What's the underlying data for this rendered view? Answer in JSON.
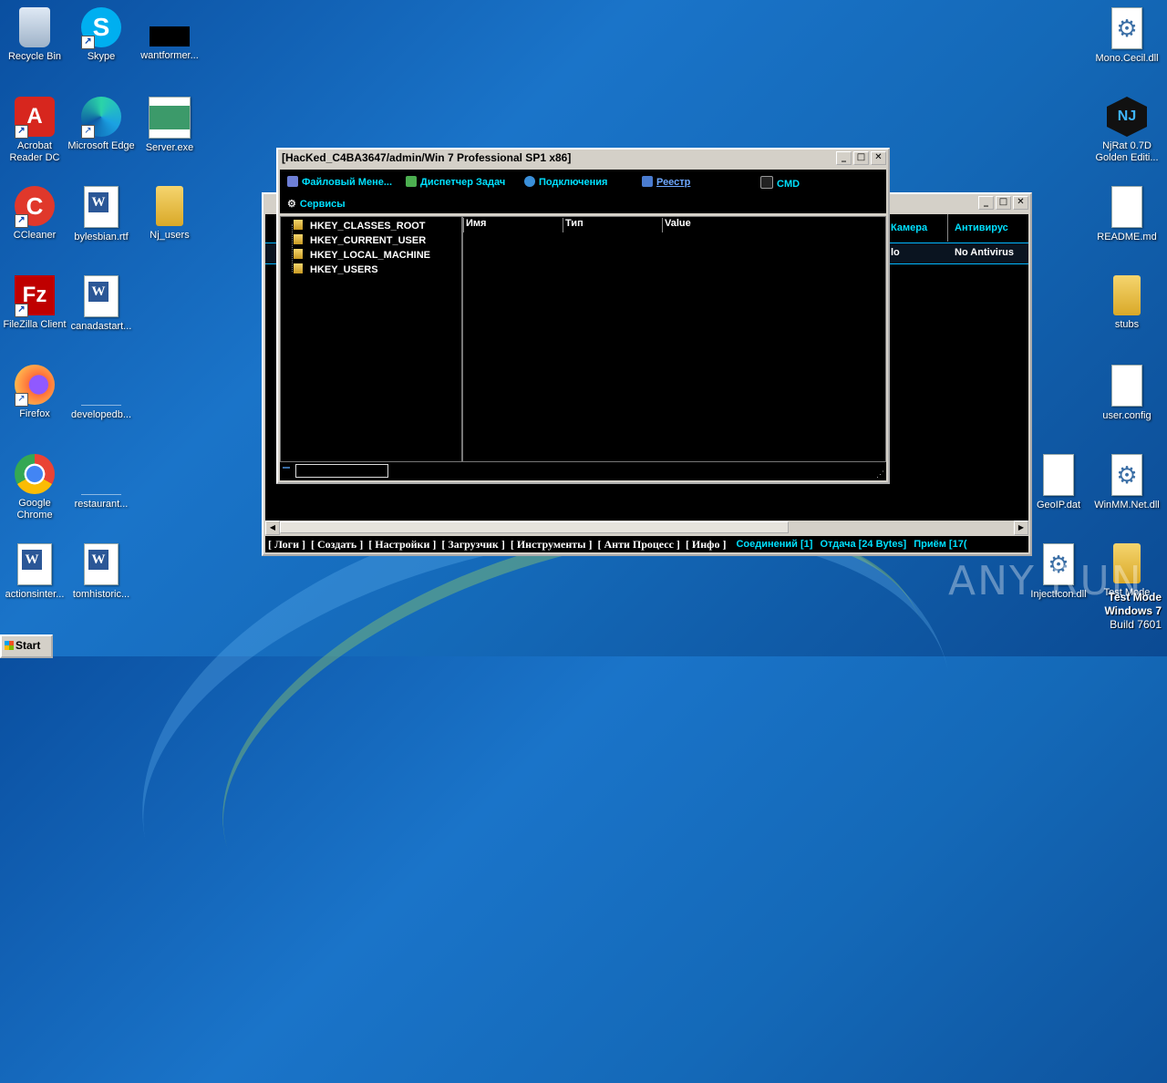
{
  "desktop": {
    "icons": [
      {
        "label": "Recycle Bin"
      },
      {
        "label": "Skype"
      },
      {
        "label": "wantformer..."
      },
      {
        "label": "Acrobat Reader DC"
      },
      {
        "label": "Microsoft Edge"
      },
      {
        "label": "Server.exe"
      },
      {
        "label": "CCleaner"
      },
      {
        "label": "bylesbian.rtf"
      },
      {
        "label": "Nj_users"
      },
      {
        "label": "FileZilla Client"
      },
      {
        "label": "canadastart..."
      },
      {
        "label": "Firefox"
      },
      {
        "label": "developedb..."
      },
      {
        "label": "Google Chrome"
      },
      {
        "label": "restaurant..."
      },
      {
        "label": "actionsinter..."
      },
      {
        "label": "tomhistoric..."
      },
      {
        "label": "Mono.Cecil.dll"
      },
      {
        "label": "NjRat 0.7D Golden Editi..."
      },
      {
        "label": "README.md"
      },
      {
        "label": "stubs"
      },
      {
        "label": "user.config"
      },
      {
        "label": "GeoIP.dat"
      },
      {
        "label": "WinMM.Net.dll"
      },
      {
        "label": "InjectIcon.dll"
      },
      {
        "label": "Test Mode"
      }
    ]
  },
  "back_window": {
    "headers": {
      "camera": "Камера",
      "antivirus": "Антивирус"
    },
    "row": {
      "camera_value": "lo",
      "antivirus_value": "No Antivirus"
    },
    "menu": [
      "[ Логи ]",
      "[ Создать ]",
      "[ Настройки ]",
      "[ Загрузчик ]",
      "[ Инструменты ]",
      "[ Анти Процесс ]",
      "[ Инфо ]"
    ],
    "status": {
      "connections": "Соединений [1]",
      "sent": "Отдача [24 Bytes]",
      "received": "Приём [17("
    }
  },
  "front_window": {
    "title": "[HacKed_C4BA3647/admin/Win 7 Professional SP1 x86]",
    "toolbar": {
      "file_manager": "Файловый Мене...",
      "task_manager": "Диспетчер Задач",
      "connections": "Подключения",
      "registry": "Реестр",
      "cmd": "CMD",
      "services": "Сервисы"
    },
    "tree": [
      "HKEY_CLASSES_ROOT",
      "HKEY_CURRENT_USER",
      "HKEY_LOCAL_MACHINE",
      "HKEY_USERS"
    ],
    "columns": {
      "name": "Имя",
      "type": "Тип",
      "value": "Value"
    },
    "path_value": ""
  },
  "taskbar": {
    "start": "Start"
  },
  "watermark": "ANY RUN",
  "test_mode": {
    "line1": "Test Mode",
    "line2": "Windows 7",
    "line3": "Build 7601"
  }
}
